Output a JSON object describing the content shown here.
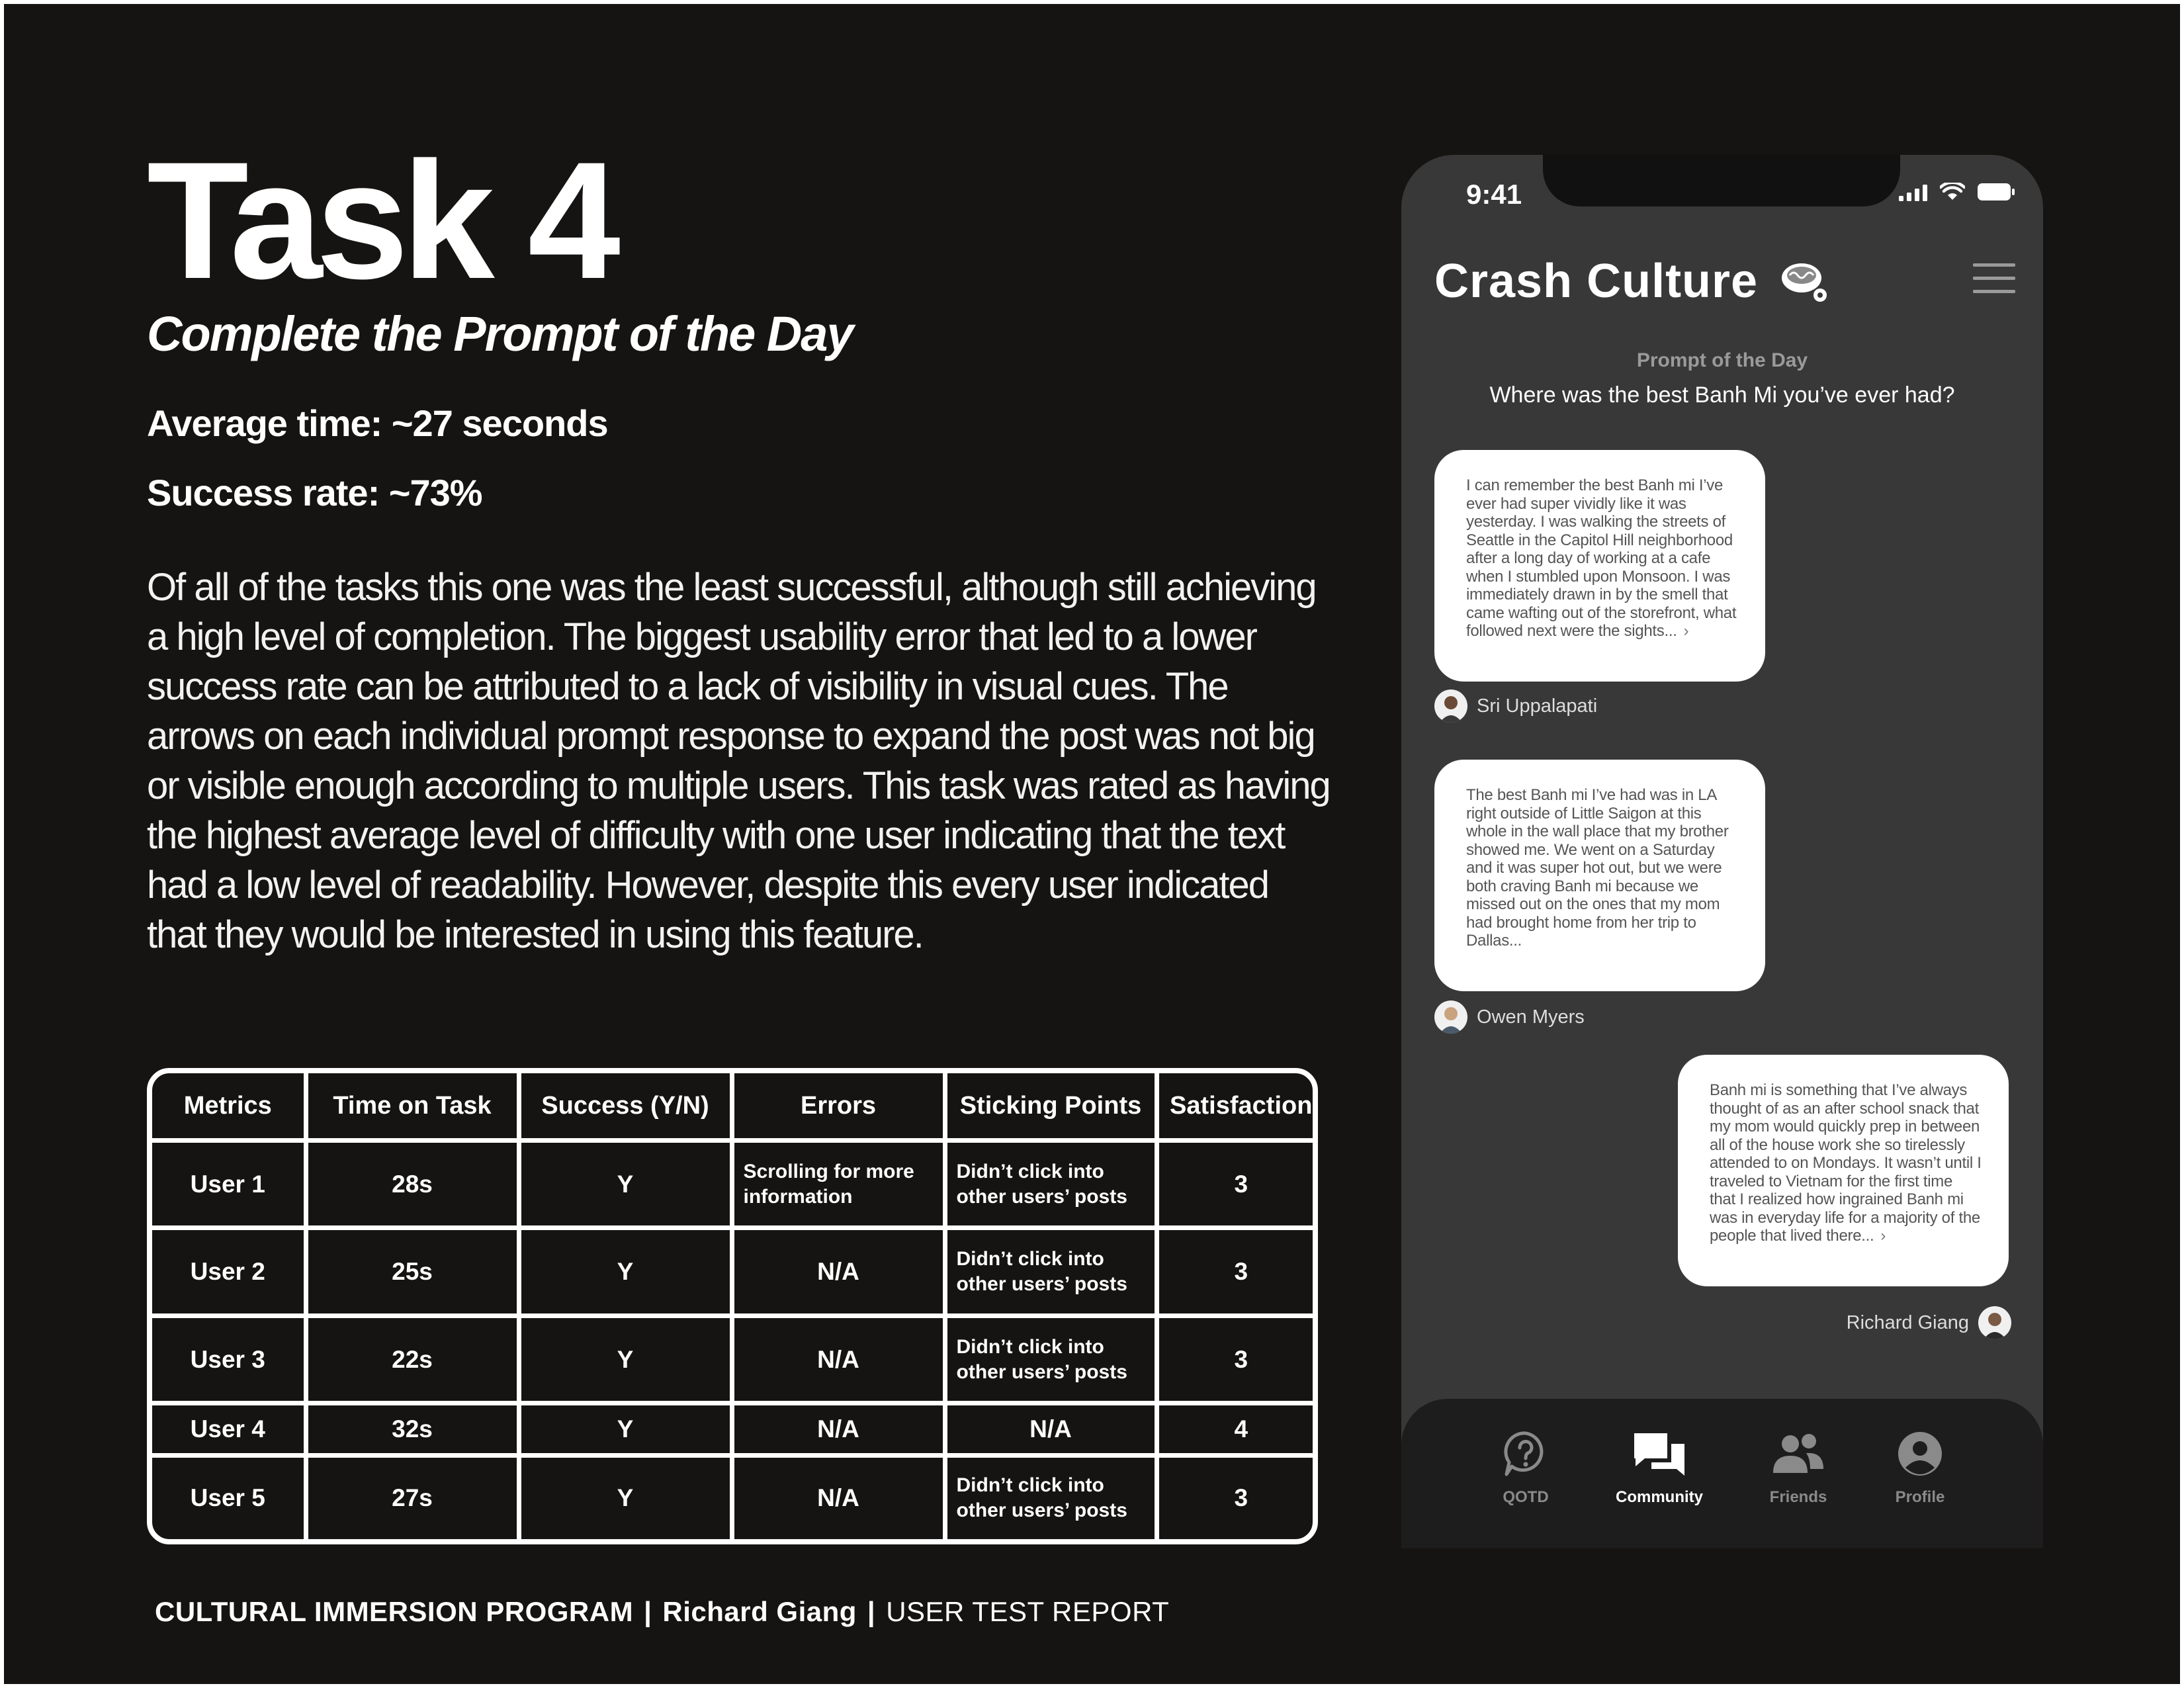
{
  "title": "Task 4",
  "subtitle": "Complete the Prompt of the Day",
  "average_time": "Average time: ~27 seconds",
  "success_rate": "Success rate:  ~73%",
  "description": "Of all of the tasks this one was the least successful, although still achieving a high level of completion. The biggest usability error that led to a lower success rate can be attributed to a lack of visibility in visual cues. The arrows on each individual prompt response to expand the post was not big or visible enough according to multiple users. This task was rated as having the highest average level of difficulty with one user indicating that the text had a low level of readability. However, despite this every user indicated that they would be interested in using this feature.",
  "table": {
    "headers": [
      "Metrics",
      "Time on Task",
      "Success (Y/N)",
      "Errors",
      "Sticking Points",
      "Satisfaction"
    ],
    "rows": [
      [
        "User 1",
        "28s",
        "Y",
        "Scrolling for more information",
        "Didn’t click into other users’ posts",
        "3"
      ],
      [
        "User 2",
        "25s",
        "Y",
        "N/A",
        "Didn’t click into other users’ posts",
        "3"
      ],
      [
        "User 3",
        "22s",
        "Y",
        "N/A",
        "Didn’t click into other users’ posts",
        "3"
      ],
      [
        "User 4",
        "32s",
        "Y",
        "N/A",
        "N/A",
        "4"
      ],
      [
        "User 5",
        "27s",
        "Y",
        "N/A",
        "Didn’t click into other users’ posts",
        "3"
      ]
    ]
  },
  "footer": {
    "program": "CULTURAL IMMERSION PROGRAM",
    "separator": "|",
    "author": "Richard Giang",
    "report": "USER TEST REPORT"
  },
  "phone": {
    "time": "9:41",
    "app_title": "Crash Culture",
    "logo_icon": "noodle-bowl-icon",
    "prompt_label": "Prompt of the Day",
    "prompt_question": "Where was the best Banh Mi you’ve ever had?",
    "posts": [
      {
        "text": "I can remember the best Banh mi I’ve ever had super vividly like it was yesterday. I was walking the streets of Seattle in the Capitol Hill neighborhood after a long day of working at a cafe when I stumbled upon Monsoon. I was immediately drawn in by the smell that came wafting out of the storefront, what followed next were the sights...",
        "author": "Sri Uppalapati",
        "expand": "›"
      },
      {
        "text": "The best Banh mi I’ve had was in LA right outside of Little Saigon at this whole in the wall place that my brother showed me. We went on a Saturday and it was super hot out, but we were both craving Banh mi because we missed out on the ones that my mom had brought home from her trip to Dallas...",
        "author": "Owen Myers"
      },
      {
        "text": "Banh mi is something that I’ve always thought of as an after school snack that my mom would quickly prep in between all of the house work she so tirelessly attended to on Mondays. It wasn’t until I traveled to Vietnam for the first time that I realized how ingrained Banh mi was in everyday life for a majority of the people that lived there...",
        "author": "Richard Giang",
        "expand": "›"
      }
    ],
    "tabs": [
      {
        "label": "QOTD",
        "icon": "question-bubble-icon"
      },
      {
        "label": "Community",
        "icon": "chat-bubbles-icon"
      },
      {
        "label": "Friends",
        "icon": "people-icon"
      },
      {
        "label": "Profile",
        "icon": "user-circle-icon"
      }
    ],
    "colors": {
      "background": "#151412",
      "phone_background": "#383838",
      "tab_bar": "#1d1d1d",
      "bubble": "#ffffff",
      "active_tab": "#ffffff",
      "inactive_tab": "#8a8a8a"
    }
  }
}
